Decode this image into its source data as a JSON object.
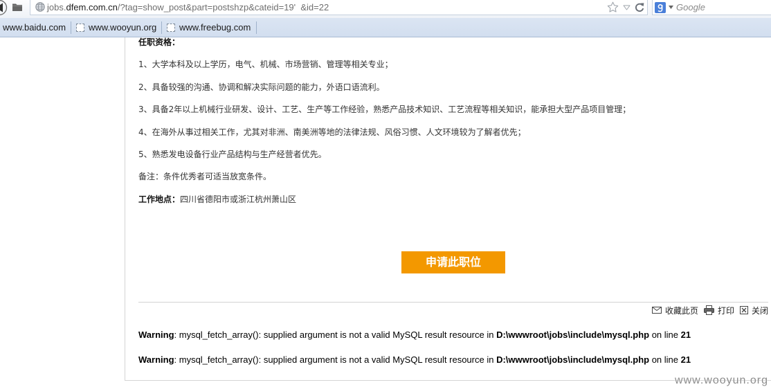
{
  "browser": {
    "url": {
      "prefix": "jobs.",
      "domain": "dfem.com.cn",
      "path": "/?tag=show_post&part=postshzp&cateid=19'  &id=22"
    },
    "search_placeholder": "Google",
    "search_engine_icon": "google-icon",
    "bookmarks": [
      {
        "label": "www.baidu.com"
      },
      {
        "label": "www.wooyun.org",
        "icon": "blank-page-icon"
      },
      {
        "label": "www.freebug.com",
        "icon": "blank-page-icon"
      }
    ]
  },
  "job": {
    "qualifications_heading": "任职资格：",
    "requirements": [
      "1、大学本科及以上学历，电气、机械、市场营销、管理等相关专业；",
      "2、具备较强的沟通、协调和解决实际问题的能力，外语口语流利。",
      "3、具备2年以上机械行业研发、设计、工艺、生产等工作经验，熟悉产品技术知识、工艺流程等相关知识，能承担大型产品项目管理；",
      "4、在海外从事过相关工作，尤其对非洲、南美洲等地的法律法规、风俗习惯、人文环境较为了解者优先；",
      "5、熟悉发电设备行业产品结构与生产经营者优先。"
    ],
    "note": "备注：条件优秀者可适当放宽条件。",
    "location_label": "工作地点：",
    "location_value": "四川省德阳市或浙江杭州萧山区",
    "apply_button": "申请此职位"
  },
  "page_actions": [
    {
      "label": "收藏此页",
      "icon": "envelope-icon"
    },
    {
      "label": "打印",
      "icon": "printer-icon"
    },
    {
      "label": "关闭",
      "icon": "close-box-icon"
    }
  ],
  "warnings": [
    {
      "level": "Warning",
      "message": ": mysql_fetch_array(): supplied argument is not a valid MySQL result resource in ",
      "file": "D:\\wwwroot\\jobs\\include\\mysql.php",
      "on_line": " on line ",
      "line": "21"
    },
    {
      "level": "Warning",
      "message": ": mysql_fetch_array(): supplied argument is not a valid MySQL result resource in ",
      "file": "D:\\wwwroot\\jobs\\include\\mysql.php",
      "on_line": " on line ",
      "line": "21"
    }
  ],
  "watermark": "www.wooyun.org",
  "colors": {
    "apply_button_bg": "#f39800",
    "apply_button_text": "#ffffff",
    "body_text": "#333333",
    "warning_text": "#000000",
    "bookmarks_bar_bg": "#dbe5f3",
    "frame_border": "#d4d4d4",
    "watermark": "#8c8c8c"
  }
}
